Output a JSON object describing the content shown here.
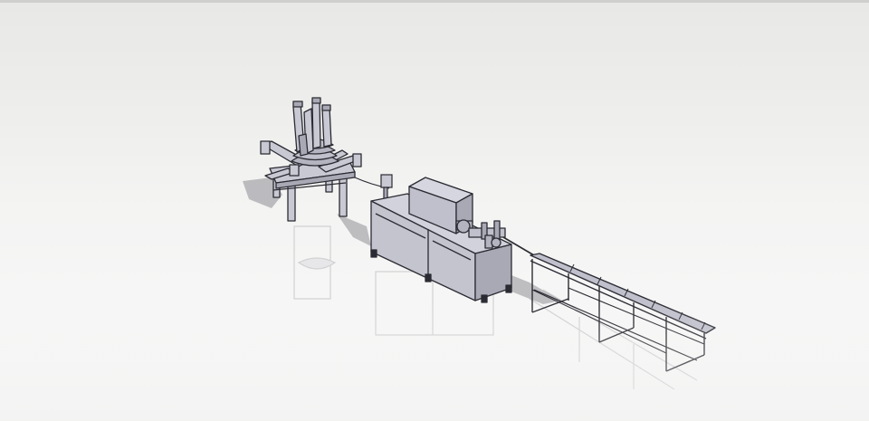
{
  "viewport": {
    "background_top": "#e8e8e6",
    "background_bottom": "#f6f6f6",
    "topbar_color": "#cfcfcd"
  },
  "model": {
    "part_fill": "#c9c9d4",
    "part_fill_dark": "#a9a9b6",
    "edge_color": "#2b2b33",
    "shadow_color": "#9a9aa0",
    "components": [
      "payoff-reel-stand",
      "control-box",
      "straightening-cutting-machine",
      "receiving-rack"
    ]
  }
}
